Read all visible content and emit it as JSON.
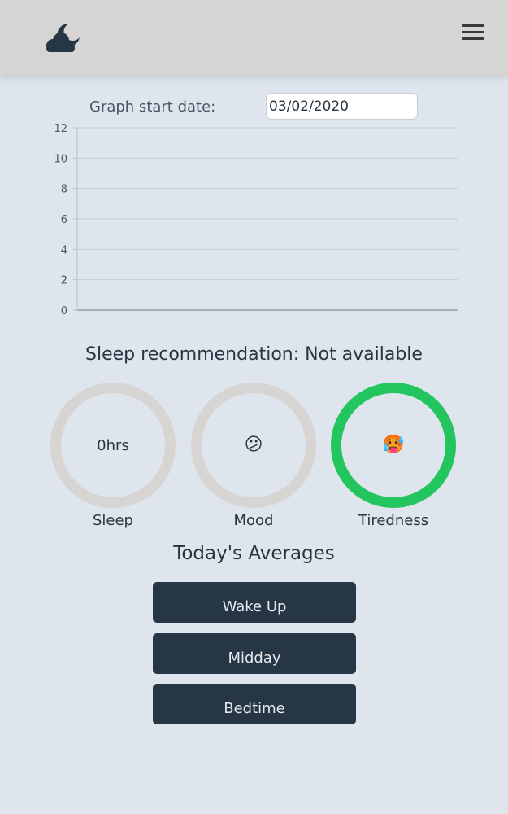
{
  "header": {
    "logo_icon": "moon-cloud-icon",
    "menu_icon": "hamburger-menu-icon"
  },
  "graph": {
    "start_label": "Graph start date:",
    "start_value": "03/02/2020"
  },
  "chart_data": {
    "type": "line",
    "x": [],
    "series": [],
    "yticks": [
      "0",
      "2",
      "4",
      "6",
      "8",
      "10",
      "12"
    ],
    "ylim": [
      0,
      12
    ],
    "grid": true
  },
  "recommendation": "Sleep recommendation: Not available",
  "metrics": {
    "sleep": {
      "value": "0hrs",
      "label": "Sleep"
    },
    "mood": {
      "value": "😕",
      "label": "Mood"
    },
    "tiredness": {
      "value": "🥵",
      "label": "Tiredness",
      "ring_color": "#22c55e"
    }
  },
  "averages": {
    "title": "Today's Averages",
    "buttons": [
      "Wake Up",
      "Midday",
      "Bedtime"
    ]
  },
  "colors": {
    "background": "#dfe5ed",
    "header": "#d6d5d4",
    "button": "#263644",
    "ring_neutral": "#d6d5d4"
  }
}
